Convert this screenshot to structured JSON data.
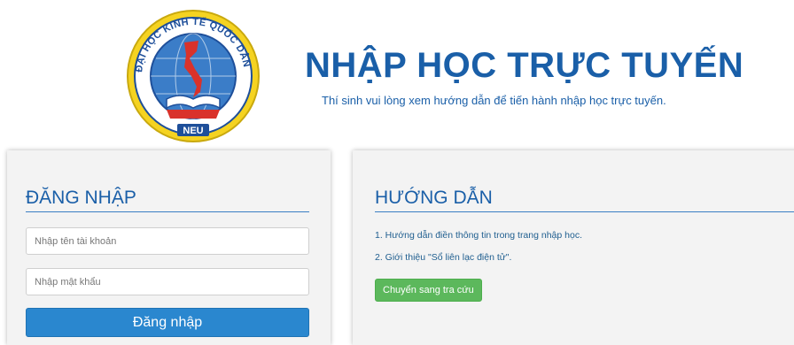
{
  "header": {
    "logo_text": "ĐẠI HỌC KINH TẾ QUỐC DÂN",
    "logo_badge": "NEU",
    "title": "NHẬP HỌC TRỰC TUYẾN",
    "subtitle": "Thí sinh vui lòng xem hướng dẫn để tiến hành nhập học trực tuyến."
  },
  "login": {
    "title": "ĐĂNG NHẬP",
    "username_placeholder": "Nhập tên tài khoản",
    "username_value": "",
    "password_placeholder": "Nhập mật khẩu",
    "password_value": "",
    "submit_label": "Đăng nhập"
  },
  "guide": {
    "title": "HƯỚNG DẪN",
    "items": [
      "1. Hướng dẫn điền thông tin trong trang nhập học.",
      "2. Giới thiệu \"Sổ liên lạc điện tử\"."
    ],
    "button_label": "Chuyển sang tra cứu"
  },
  "colors": {
    "brand_blue": "#1a5fa8",
    "login_button": "#2a87cf",
    "success_button": "#5cb85c",
    "panel_bg": "#f3f3f3"
  }
}
